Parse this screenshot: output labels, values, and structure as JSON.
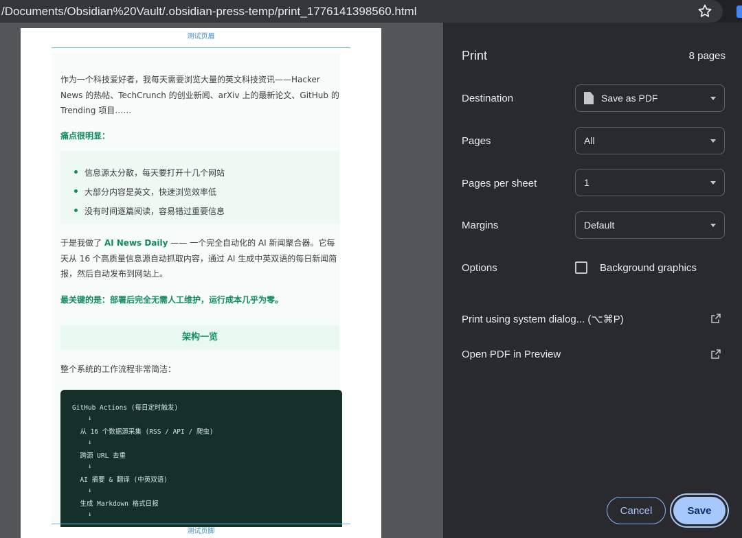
{
  "browser": {
    "url": "/Documents/Obsidian%20Vault/.obsidian-press-temp/print_1776141398560.html"
  },
  "preview": {
    "header": "测试页眉",
    "footer": "测试页脚",
    "intro": "作为一个科技爱好者，我每天需要浏览大量的英文科技资讯——Hacker News 的热帖、TechCrunch 的创业新闻、arXiv 上的最新论文、GitHub 的 Trending 项目……",
    "pain_title": "痛点很明显：",
    "pain_points": [
      "信息源太分散，每天要打开十几个网站",
      "大部分内容是英文，快速浏览效率低",
      "没有时间逐篇阅读，容易错过重要信息"
    ],
    "solution_pre": "于是我做了 ",
    "solution_name": "AI News Daily",
    "solution_post": " —— 一个完全自动化的 AI 新闻聚合器。它每天从 16 个高质量信息源自动抓取内容，通过 AI 生成中英双语的每日新闻简报，然后自动发布到网站上。",
    "key_point": "最关键的是：部署后完全无需人工维护，运行成本几乎为零。",
    "section_title": "架构一览",
    "flow_intro": "整个系统的工作流程非常简洁：",
    "code_lines": [
      "GitHub Actions (每日定时触发)",
      "    ↓",
      "  从 16 个数据源采集 (RSS / API / 爬虫)",
      "    ↓",
      "  跨源 URL 去重",
      "    ↓",
      "  AI 摘要 & 翻译 (中英双语)",
      "    ↓",
      "  生成 Markdown 格式日报",
      "    ↓"
    ]
  },
  "print_panel": {
    "title": "Print",
    "page_count": "8 pages",
    "destination_label": "Destination",
    "destination_value": "Save as PDF",
    "pages_label": "Pages",
    "pages_value": "All",
    "pps_label": "Pages per sheet",
    "pps_value": "1",
    "margins_label": "Margins",
    "margins_value": "Default",
    "options_label": "Options",
    "bg_graphics_label": "Background graphics",
    "bg_graphics_checked": false,
    "system_dialog": "Print using system dialog... (⌥⌘P)",
    "open_preview": "Open PDF in Preview",
    "cancel": "Cancel",
    "save": "Save"
  },
  "colors": {
    "accent_green": "#138a63",
    "header_blue": "#3b8ec9",
    "panel_bg": "#292a2d",
    "save_button": "#a8c7fa"
  }
}
